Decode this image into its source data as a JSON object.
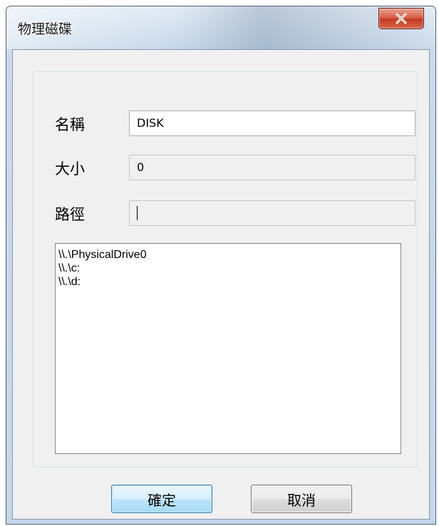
{
  "window": {
    "title": "物理磁碟",
    "close_icon": "close-icon"
  },
  "form": {
    "name_label": "名稱",
    "name_value": "DISK",
    "size_label": "大小",
    "size_value": "0",
    "path_label": "路徑",
    "path_value": ""
  },
  "drive_list": {
    "items": [
      "\\\\.\\PhysicalDrive0",
      "\\\\.\\c:",
      "\\\\.\\d:"
    ]
  },
  "buttons": {
    "ok_label": "確定",
    "cancel_label": "取消"
  }
}
